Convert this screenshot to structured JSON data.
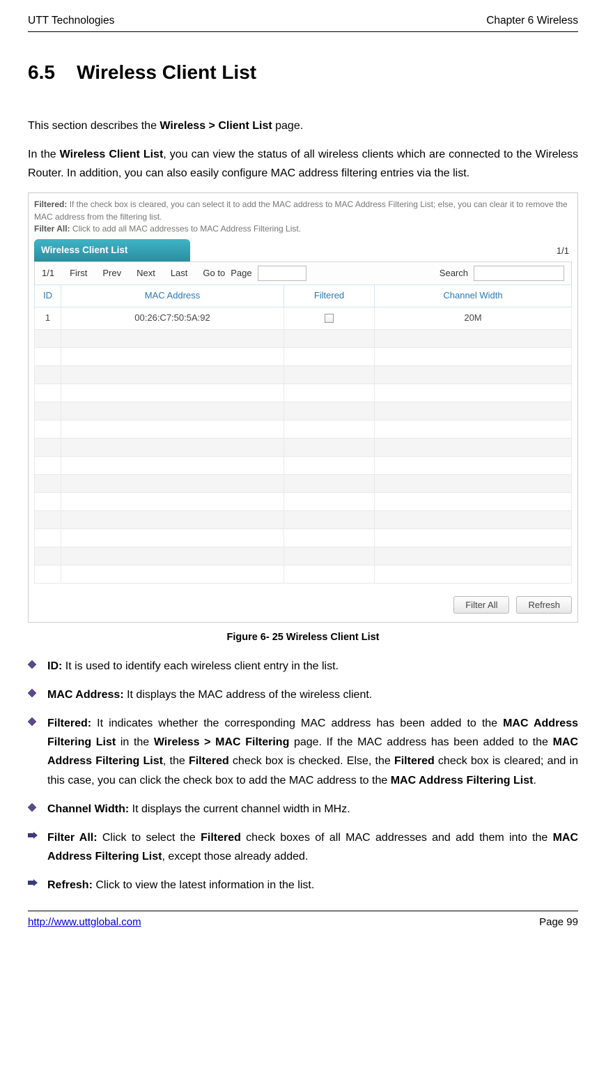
{
  "header": {
    "left": "UTT Technologies",
    "right": "Chapter 6 Wireless"
  },
  "section": {
    "number": "6.5",
    "title": "Wireless Client List"
  },
  "intro1_pre": "This section describes the ",
  "intro1_bold": "Wireless > Client List",
  "intro1_post": " page.",
  "intro2_a": "In the ",
  "intro2_b": "Wireless Client List",
  "intro2_c": ", you can view the status of all wireless clients which are connected to the Wireless Router. In addition, you can also easily configure MAC address filtering entries via the list.",
  "ss": {
    "help_filtered_label": "Filtered:",
    "help_filtered_text": " If the check box is cleared, you can select it to add the MAC address to MAC Address Filtering List; else, you can clear it to remove the MAC address from the filtering list.",
    "help_filterall_label": "Filter All:",
    "help_filterall_text": " Click to add all MAC addresses to MAC Address Filtering List.",
    "tab_title": "Wireless Client List",
    "page_ind": "1/1",
    "pager": {
      "counter": "1/1",
      "first": "First",
      "prev": "Prev",
      "next": "Next",
      "last": "Last",
      "goto": "Go to",
      "page": "Page",
      "search": "Search"
    },
    "cols": [
      "ID",
      "MAC Address",
      "Filtered",
      "Channel Width"
    ],
    "row1": {
      "id": "1",
      "mac": "00:26:C7:50:5A:92",
      "width": "20M"
    },
    "btn_filter_all": "Filter All",
    "btn_refresh": "Refresh"
  },
  "figcap": "Figure 6- 25 Wireless Client List",
  "defs": {
    "id_label": "ID:",
    "id_text": " It is used to identify each wireless client entry in the list.",
    "mac_label": "MAC Address:",
    "mac_text": " It displays the MAC address of the wireless client.",
    "filt_label": "Filtered:",
    "filt_t1": " It indicates whether the corresponding MAC address has been added to the ",
    "filt_b1": "MAC Address Filtering List",
    "filt_t2": " in the ",
    "filt_b2": "Wireless > MAC Filtering",
    "filt_t3": " page. If the MAC address has been added to the ",
    "filt_b3": "MAC Address Filtering List",
    "filt_t4": ", the ",
    "filt_b4": "Filtered",
    "filt_t5": " check box is checked. Else, the ",
    "filt_b5": "Filtered",
    "filt_t6": " check box is cleared; and in this case, you can click the check box to add the MAC address to the ",
    "filt_b6": "MAC Address Filtering List",
    "filt_t7": ".",
    "cw_label": "Channel Width:",
    "cw_text": " It displays the current channel width in MHz.",
    "fa_label": "Filter All:",
    "fa_t1": " Click to select the ",
    "fa_b1": "Filtered",
    "fa_t2": " check boxes of all MAC addresses and add them into the ",
    "fa_b2": "MAC Address Filtering List",
    "fa_t3": ", except those already added.",
    "ref_label": "Refresh:",
    "ref_text": " Click to view the latest information in the list."
  },
  "footer": {
    "url": "http://www.uttglobal.com",
    "page": "Page 99"
  }
}
